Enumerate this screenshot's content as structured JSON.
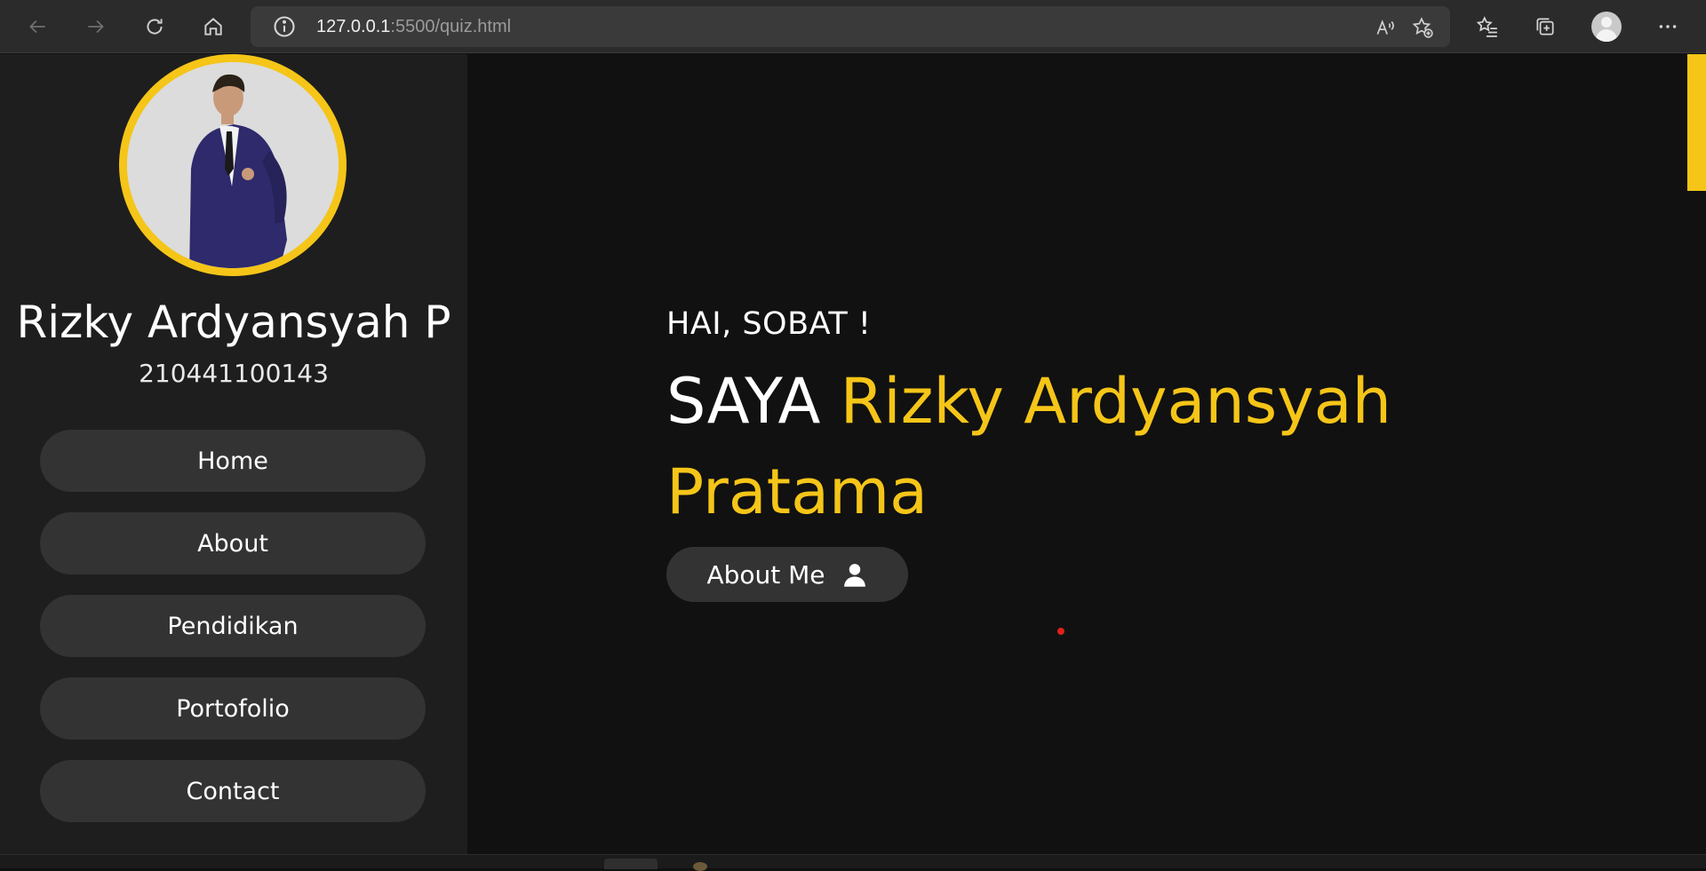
{
  "browser": {
    "url_host": "127.0.0.1",
    "url_rest": ":5500/quiz.html"
  },
  "sidebar": {
    "name": "Rizky Ardyansyah P",
    "nim": "210441100143",
    "items": [
      {
        "label": "Home"
      },
      {
        "label": "About"
      },
      {
        "label": "Pendidikan"
      },
      {
        "label": "Portofolio"
      },
      {
        "label": "Contact"
      }
    ]
  },
  "hero": {
    "greeting": "HAI, SOBAT !",
    "prefix": "SAYA",
    "highlight": "Rizky Ardyansyah Pratama",
    "button_label": "About Me"
  },
  "colors": {
    "accent": "#f5c518",
    "sidebar_bg": "#1e1e1e",
    "main_bg": "#111111",
    "button_bg": "#333333"
  }
}
